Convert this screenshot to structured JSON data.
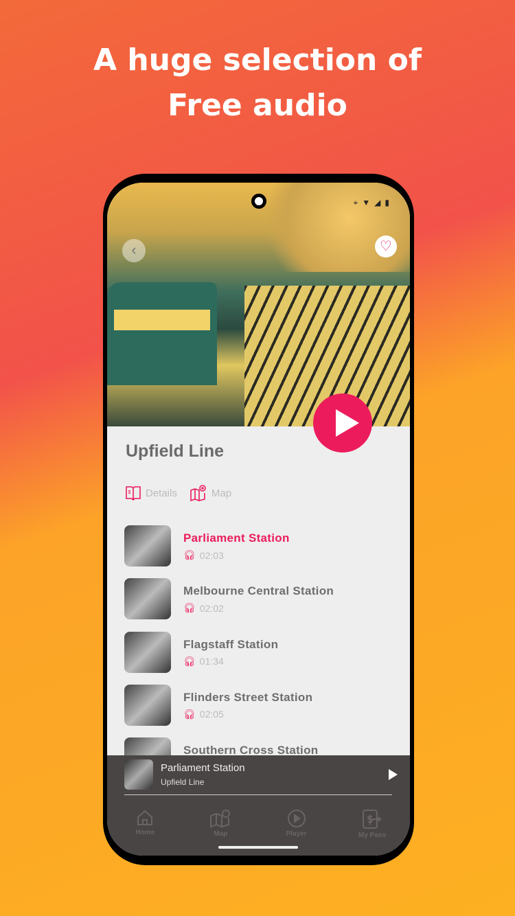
{
  "headline": {
    "line1": "A huge selection of",
    "line2": "Free audio"
  },
  "tour": {
    "title": "Upfield Line"
  },
  "tabs": [
    {
      "label": "Details",
      "icon": "book-icon"
    },
    {
      "label": "Map",
      "icon": "map-pin-icon"
    }
  ],
  "stations": [
    {
      "name": "Parliament Station",
      "duration": "02:03",
      "active": true
    },
    {
      "name": "Melbourne Central Station",
      "duration": "02:02"
    },
    {
      "name": "Flagstaff Station",
      "duration": "01:34"
    },
    {
      "name": "Flinders Street Station",
      "duration": "02:05"
    },
    {
      "name": "Southern Cross Station",
      "duration": ""
    }
  ],
  "mini_player": {
    "title": "Parliament Station",
    "subtitle": "Upfield Line"
  },
  "nav": [
    {
      "label": "Home",
      "icon": "home-icon"
    },
    {
      "label": "Map",
      "icon": "map-icon"
    },
    {
      "label": "Player",
      "icon": "play-circle-icon"
    },
    {
      "label": "My Pass",
      "icon": "pass-icon"
    }
  ],
  "colors": {
    "accent": "#ec1c5c",
    "player_bg": "#4a4545",
    "content_bg": "#eeeeee"
  }
}
